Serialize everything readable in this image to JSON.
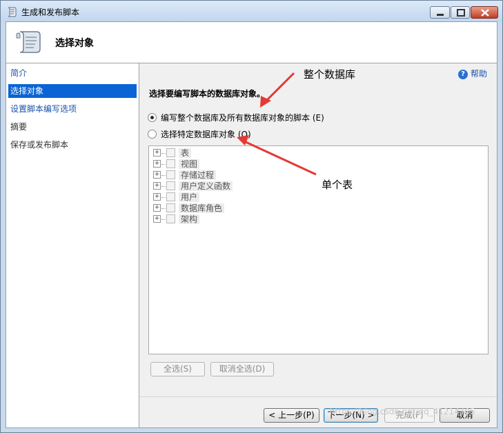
{
  "window": {
    "title": "生成和发布脚本"
  },
  "header": {
    "title": "选择对象"
  },
  "sidebar": {
    "items": [
      {
        "label": "简介",
        "state": "link"
      },
      {
        "label": "选择对象",
        "state": "selected"
      },
      {
        "label": "设置脚本编写选项",
        "state": "link"
      },
      {
        "label": "摘要",
        "state": "plain"
      },
      {
        "label": "保存或发布脚本",
        "state": "plain"
      }
    ]
  },
  "help": {
    "label": "帮助"
  },
  "main": {
    "prompt": "选择要编写脚本的数据库对象。",
    "options": [
      {
        "label": "编写整个数据库及所有数据库对象的脚本 (E)",
        "checked": true
      },
      {
        "label": "选择特定数据库对象 (O)",
        "checked": false
      }
    ],
    "tree_items": [
      "表",
      "视图",
      "存储过程",
      "用户定义函数",
      "用户",
      "数据库角色",
      "架构"
    ],
    "select_all": "全选(S)",
    "deselect_all": "取消全选(D)"
  },
  "footer": {
    "prev": "< 上一步(P)",
    "next": "下一步(N) >",
    "finish": "完成(F)",
    "cancel": "取消"
  },
  "annotations": {
    "whole_db": "整个数据库",
    "single_table": "单个表"
  },
  "watermark": "https://blog.csdn.net/qq_41214405",
  "colors": {
    "accent": "#0a64d6",
    "link": "#1a53a8",
    "arrow": "#e53935"
  }
}
